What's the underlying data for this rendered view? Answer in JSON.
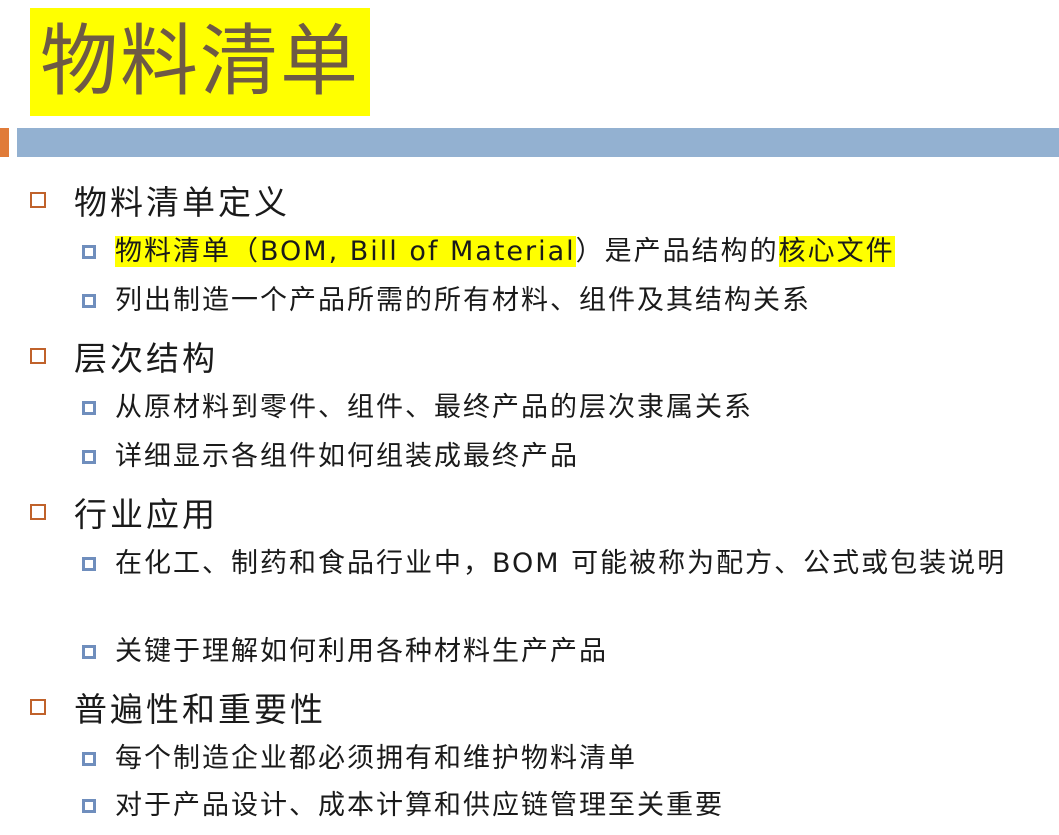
{
  "title": "物料清单",
  "colors": {
    "title_bg": "#ffff00",
    "title_text": "#6e5a45",
    "title_bar": "#93b1d1",
    "accent": "#e07b39",
    "level1_bullet": "#c0622b",
    "level2_bullet": "#6f8ebd",
    "highlight": "#ffff00"
  },
  "sections": [
    {
      "heading": "物料清单定义",
      "items": [
        {
          "hl_a": "物料清单（BOM, Bill of Material",
          "plain": "）是产品结构的",
          "hl_b": "核心文件"
        },
        {
          "text": "列出制造一个产品所需的所有材料、组件及其结构关系"
        }
      ]
    },
    {
      "heading": "层次结构",
      "items": [
        {
          "text": "从原材料到零件、组件、最终产品的层次隶属关系"
        },
        {
          "text": "详细显示各组件如何组装成最终产品"
        }
      ]
    },
    {
      "heading": "行业应用",
      "items": [
        {
          "text": "在化工、制药和食品行业中，BOM 可能被称为配方、公式或包装说明"
        },
        {
          "text": "关键于理解如何利用各种材料生产产品"
        }
      ]
    },
    {
      "heading": "普遍性和重要性",
      "items": [
        {
          "text": "每个制造企业都必须拥有和维护物料清单"
        },
        {
          "text": "对于产品设计、成本计算和供应链管理至关重要"
        }
      ]
    }
  ]
}
